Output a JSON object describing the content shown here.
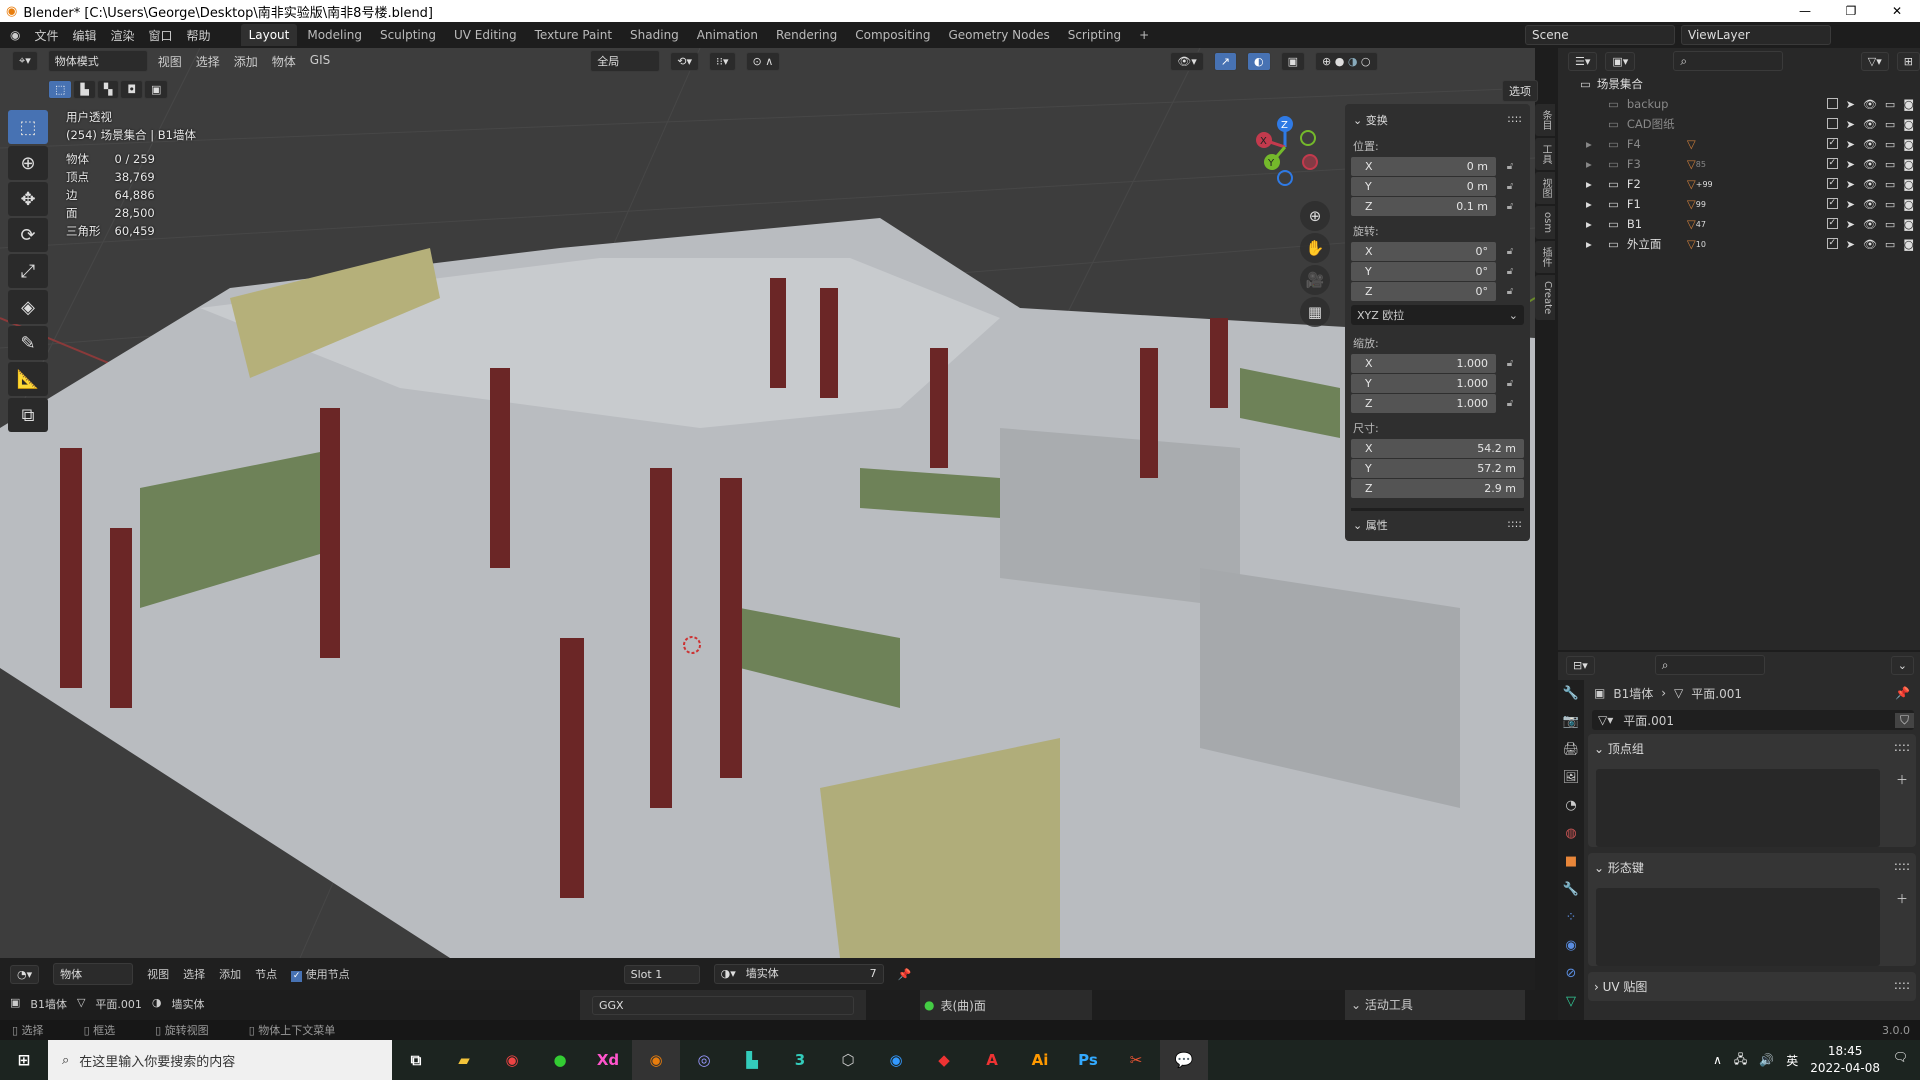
{
  "title": "Blender* [C:\\Users\\George\\Desktop\\南非实验版\\南非8号楼.blend]",
  "menu": [
    "文件",
    "编辑",
    "渲染",
    "窗口",
    "帮助"
  ],
  "workspaces": [
    "Layout",
    "Modeling",
    "Sculpting",
    "UV Editing",
    "Texture Paint",
    "Shading",
    "Animation",
    "Rendering",
    "Compositing",
    "Geometry Nodes",
    "Scripting",
    "+"
  ],
  "active_workspace": "Layout",
  "scene": "Scene",
  "view_layer": "ViewLayer",
  "viewport": {
    "mode": "物体模式",
    "menus": [
      "视图",
      "选择",
      "添加",
      "物体",
      "GIS"
    ],
    "orientation": "全局",
    "options": "选项",
    "view_name": "用户透视",
    "context": "(254) 场景集合 | B1墙体",
    "stats": [
      {
        "k": "物体",
        "v": "0 / 259"
      },
      {
        "k": "顶点",
        "v": "38,769"
      },
      {
        "k": "边",
        "v": "64,886"
      },
      {
        "k": "面",
        "v": "28,500"
      },
      {
        "k": "三角形",
        "v": "60,459"
      }
    ],
    "gizmo": {
      "x": "X",
      "y": "Y",
      "z": "Z"
    }
  },
  "npanel": {
    "transform": "变换",
    "location": "位置:",
    "rotation": "旋转:",
    "scale": "缩放:",
    "dimensions": "尺寸:",
    "loc": [
      {
        "a": "X",
        "v": "0 m"
      },
      {
        "a": "Y",
        "v": "0 m"
      },
      {
        "a": "Z",
        "v": "0.1 m"
      }
    ],
    "rot": [
      {
        "a": "X",
        "v": "0°"
      },
      {
        "a": "Y",
        "v": "0°"
      },
      {
        "a": "Z",
        "v": "0°"
      }
    ],
    "rot_mode": "XYZ 欧拉",
    "scl": [
      {
        "a": "X",
        "v": "1.000"
      },
      {
        "a": "Y",
        "v": "1.000"
      },
      {
        "a": "Z",
        "v": "1.000"
      }
    ],
    "dim": [
      {
        "a": "X",
        "v": "54.2 m"
      },
      {
        "a": "Y",
        "v": "57.2 m"
      },
      {
        "a": "Z",
        "v": "2.9 m"
      }
    ],
    "properties": "属性",
    "tabs": [
      "条目",
      "工具",
      "视图",
      "osm",
      "插件",
      "Create"
    ]
  },
  "outliner": {
    "root": "场景集合",
    "items": [
      {
        "name": "backup",
        "checked": false,
        "dim": true,
        "count": ""
      },
      {
        "name": "CAD图纸",
        "checked": false,
        "dim": true,
        "count": ""
      },
      {
        "name": "F4",
        "checked": true,
        "dim": true,
        "count": ""
      },
      {
        "name": "F3",
        "checked": true,
        "dim": true,
        "count": "85"
      },
      {
        "name": "F2",
        "checked": true,
        "dim": false,
        "count": "+99"
      },
      {
        "name": "F1",
        "checked": true,
        "dim": false,
        "count": "99"
      },
      {
        "name": "B1",
        "checked": true,
        "dim": false,
        "count": "47"
      },
      {
        "name": "外立面",
        "checked": true,
        "dim": false,
        "count": "10"
      }
    ]
  },
  "properties": {
    "object": "B1墙体",
    "mesh": "平面.001",
    "mesh_field": "平面.001",
    "vertex_groups": "顶点组",
    "shape_keys": "形态键",
    "uv_maps": "UV 贴图"
  },
  "shader": {
    "mode": "物体",
    "menus": [
      "视图",
      "选择",
      "添加",
      "节点"
    ],
    "use_nodes": "使用节点",
    "slot": "Slot 1",
    "material": "墙实体",
    "users": "7",
    "breadcrumb": [
      "B1墙体",
      "平面.001",
      "墙实体"
    ],
    "distribution": "GGX",
    "socket": "表(曲)面",
    "active_tool": "活动工具"
  },
  "status": [
    "选择",
    "框选",
    "旋转视图",
    "物体上下文菜单"
  ],
  "version": "3.0.0",
  "taskbar": {
    "search": "在这里输入你要搜索的内容",
    "time": "18:45",
    "date": "2022-04-08",
    "ime": "英"
  }
}
